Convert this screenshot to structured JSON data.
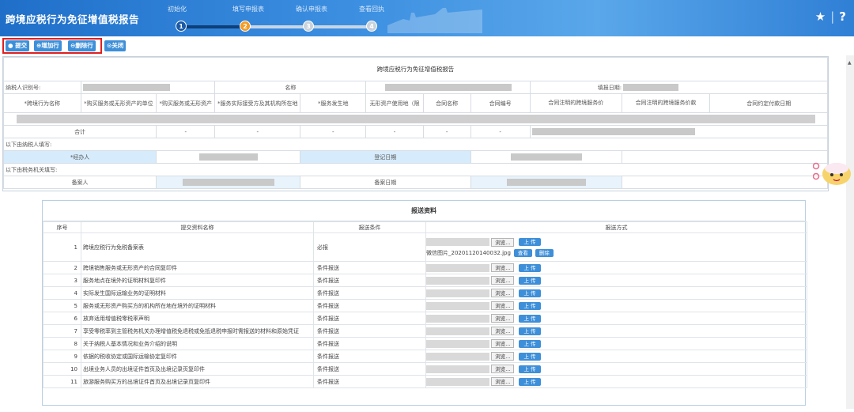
{
  "header": {
    "title": "跨境应税行为免征增值税报告",
    "steps": [
      {
        "num": "1",
        "label": "初始化"
      },
      {
        "num": "2",
        "label": "填写申报表"
      },
      {
        "num": "3",
        "label": "确认申报表"
      },
      {
        "num": "4",
        "label": "查看回执"
      }
    ],
    "star_icon": "★",
    "help_icon": "?"
  },
  "toolbar": {
    "submit": "提交",
    "add_row": "增加行",
    "delete_row": "删除行",
    "close": "关闭"
  },
  "form": {
    "title": "跨境应税行为免征增值税报告",
    "taxpayer_id_label": "纳税人识别号:",
    "name_label": "名称",
    "fill_date_label": "填报日期:",
    "columns": [
      "*跨境行为名称",
      "*购买服务或无形资产的单位",
      "*购买服务或无形资产",
      "*服务实际接受方及其机构所在地",
      "*服务发生地",
      "无形资产使用地（限",
      "合同名称",
      "合同编号",
      "合同注明的跨境服务价",
      "合同注明的跨境服务价款",
      "合同约定付款日期"
    ],
    "total_label": "合计",
    "dash": "-",
    "taxpayer_fill_note": "以下由纳税人填写:",
    "handler_label": "*经办人",
    "reg_date_label": "登记日期",
    "tax_office_note": "以下由税务机关填写:",
    "recorder_label": "备案人",
    "record_date_label": "备案日期"
  },
  "docs": {
    "title": "报送资料",
    "headers": [
      "序号",
      "提交资料名称",
      "报送条件",
      "报送方式"
    ],
    "browse_label": "浏览...",
    "upload_label": "上 传",
    "view_label": "查看",
    "delete_label": "删除",
    "uploaded_file": "微信图片_20201120140032.jpg",
    "rows": [
      {
        "no": "1",
        "name": "跨境应税行为免税备案表",
        "cond": "必报"
      },
      {
        "no": "2",
        "name": "跨境销售服务或无形资产的合同复印件",
        "cond": "条件报送"
      },
      {
        "no": "3",
        "name": "服务地点在境外的证明材料复印件",
        "cond": "条件报送"
      },
      {
        "no": "4",
        "name": "实际发生国际运输业务的证明材料",
        "cond": "条件报送"
      },
      {
        "no": "5",
        "name": "服务或无形资产购买方的机构所在地在境外的证明材料",
        "cond": "条件报送"
      },
      {
        "no": "6",
        "name": "放弃适用增值税零税率声明",
        "cond": "条件报送"
      },
      {
        "no": "7",
        "name": "享受零税率到主管税务机关办理增值税免退税或免抵退税申报时需报送的材料和原始凭证",
        "cond": "条件报送"
      },
      {
        "no": "8",
        "name": "关于纳税人基本情况和业务介绍的说明",
        "cond": "条件报送"
      },
      {
        "no": "9",
        "name": "依据的税收协定或国际运输协定复印件",
        "cond": "条件报送"
      },
      {
        "no": "10",
        "name": "出境业务人员的出境证件首页及出境记录页复印件",
        "cond": "条件报送"
      },
      {
        "no": "11",
        "name": "旅游服务购买方的出境证件首页及出境记录页复印件",
        "cond": "条件报送"
      }
    ]
  },
  "colors": {
    "header_blue": "#2f7fd6",
    "step_active": "#f39c26",
    "step_done": "#1a5aa6",
    "button_blue": "#3d8fd9",
    "highlight_red": "#e02020"
  }
}
